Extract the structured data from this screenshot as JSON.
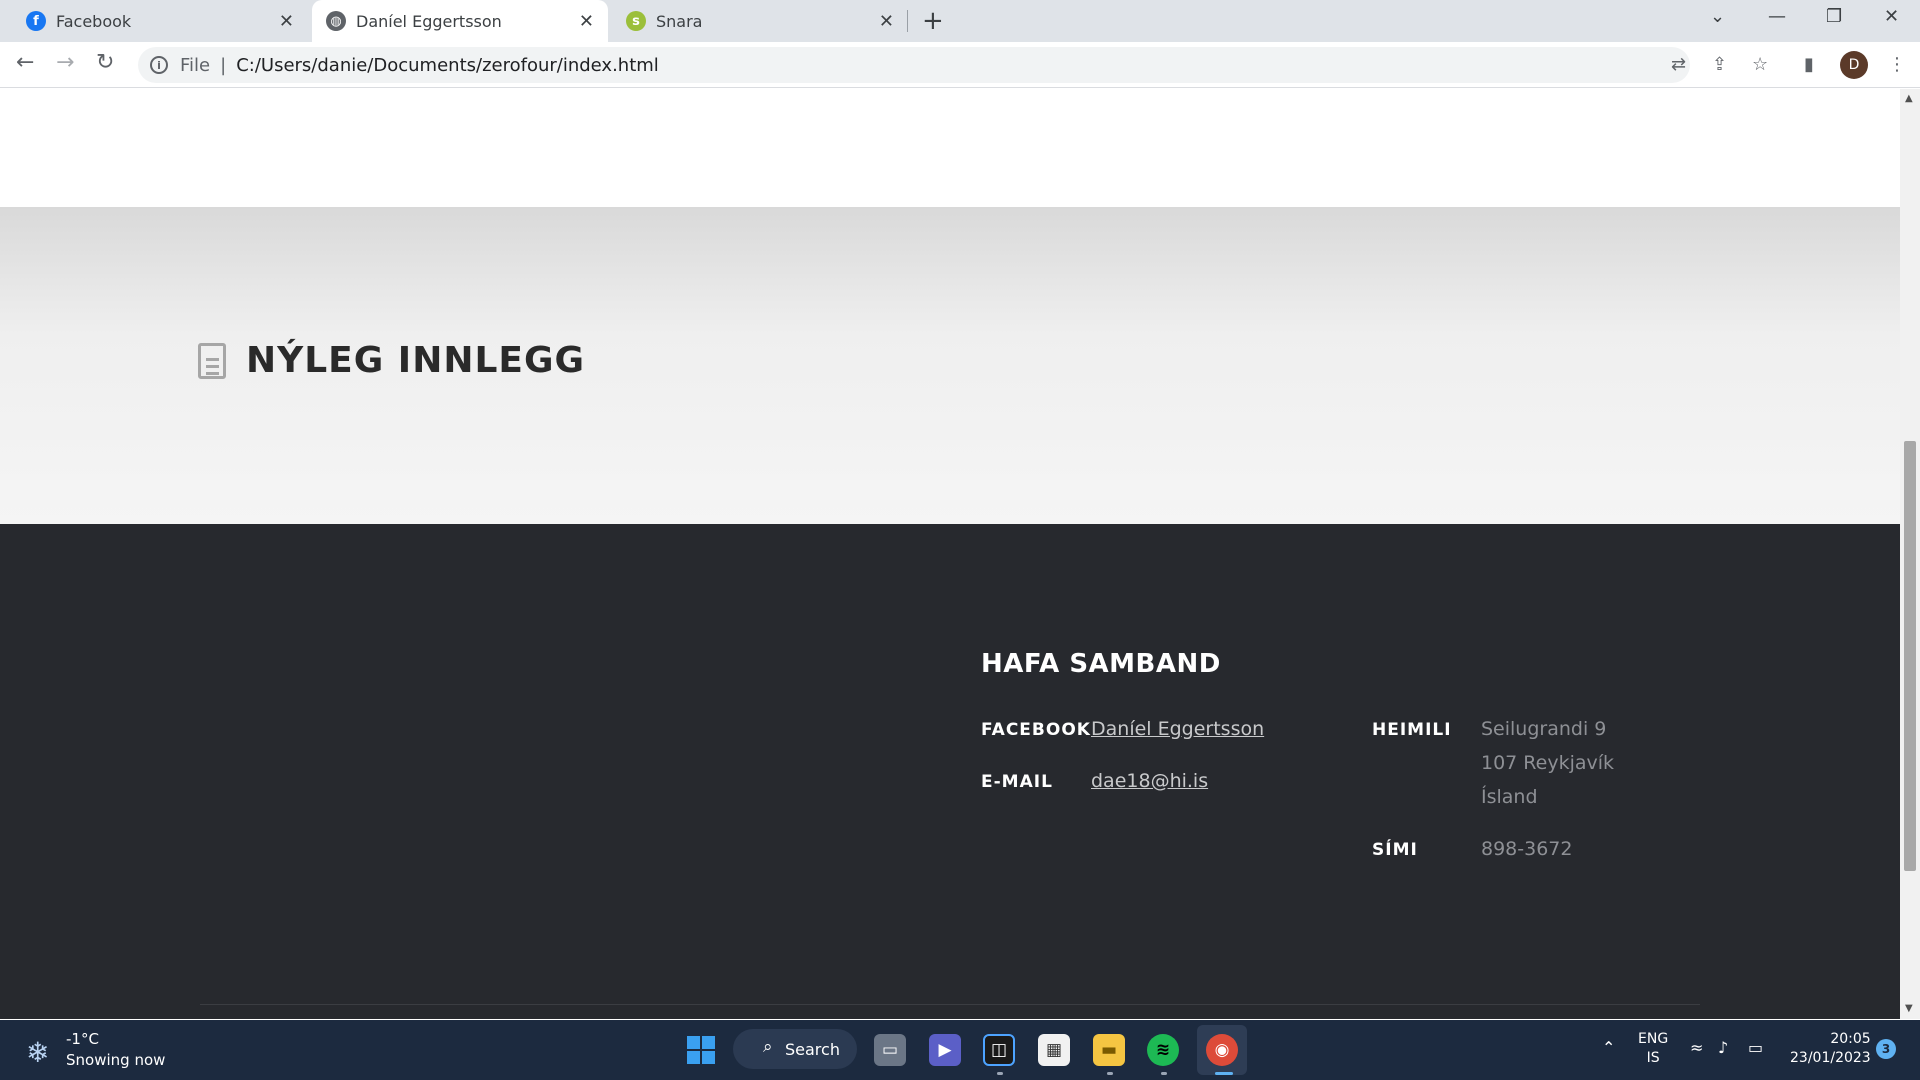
{
  "browser": {
    "tabs": [
      {
        "title": "Facebook",
        "active": false
      },
      {
        "title": "Daníel Eggertsson",
        "active": true
      },
      {
        "title": "Snara",
        "active": false
      }
    ],
    "address_scheme": "File",
    "address_url": "C:/Users/danie/Documents/zerofour/index.html",
    "profile_initial": "D"
  },
  "page": {
    "recent_section_title": "NÝLEG INNLEGG",
    "contact": {
      "heading": "HAFA SAMBAND",
      "facebook_label": "FACEBOOK",
      "facebook_value": "Daníel Eggertsson",
      "email_label": "E-MAIL",
      "email_value": "dae18@hi.is",
      "address_label": "HEIMILI",
      "address_line1": "Seilugrandi 9",
      "address_line2": "107 Reykjavík",
      "address_line3": "Ísland",
      "phone_label": "SÍMI",
      "phone_value": "898-3672"
    }
  },
  "taskbar": {
    "weather_temp": "-1°C",
    "weather_desc": "Snowing now",
    "search_label": "Search",
    "lang_line1": "ENG",
    "lang_line2": "IS",
    "time": "20:05",
    "date": "23/01/2023",
    "notification_count": "3"
  },
  "colors": {
    "footer_bg": "#27292e",
    "taskbar_bg": "#1c2a3f",
    "tabstrip_bg": "#dfe3e8"
  }
}
